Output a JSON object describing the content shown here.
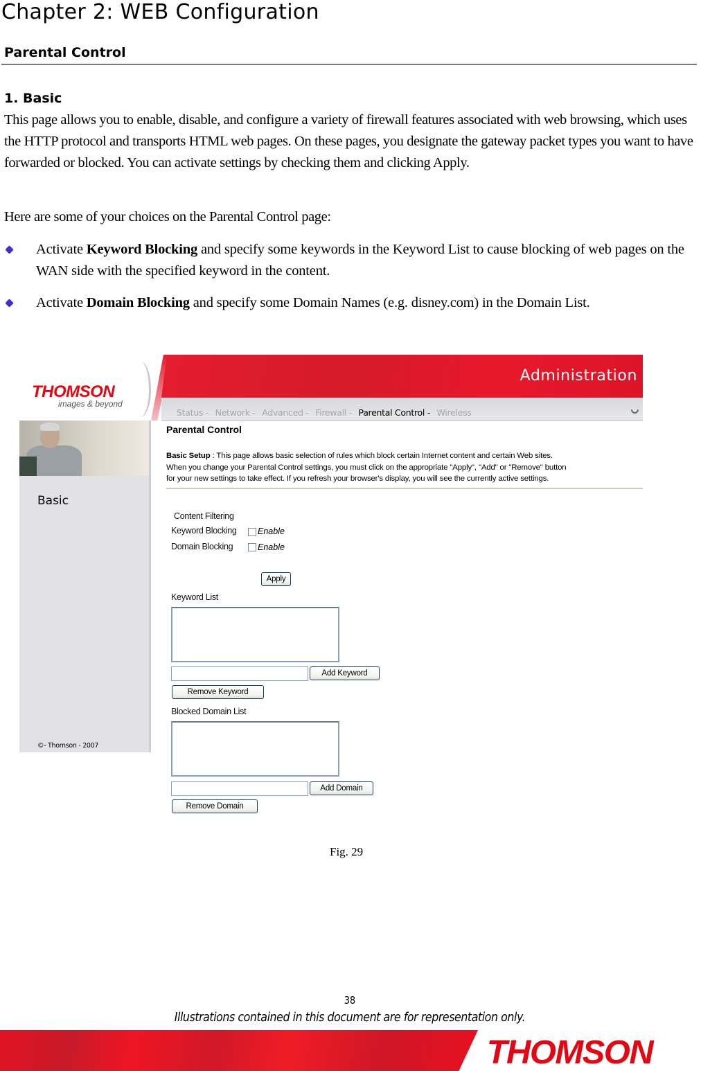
{
  "document": {
    "chapter_title": "Chapter 2: WEB Configuration",
    "section_title": "Parental Control",
    "subsection_title": "1. Basic",
    "paragraph_1": "This page allows you to enable, disable, and configure a variety of firewall features associated with web browsing, which uses the HTTP protocol and transports HTML web pages. On these pages, you designate the gateway packet types you want to have forwarded or blocked. You can activate settings by checking them and clicking Apply.",
    "paragraph_2": "Here are some of your choices on the Parental Control page:",
    "bullets": [
      {
        "prefix": "Activate ",
        "bold": "Keyword Blocking",
        "suffix": " and specify some keywords in the Keyword List to cause blocking of web pages on the WAN side with the specified keyword in the content."
      },
      {
        "prefix": "Activate ",
        "bold": "Domain Blocking",
        "suffix": " and specify some Domain Names (e.g. disney.com) in the Domain List."
      }
    ],
    "bullet_icon": "diamond-bullet-icon",
    "figure_caption": "Fig. 29",
    "page_number": "38",
    "disclaimer": "Illustrations contained in this document are for representation only.",
    "footer_logo": "THOMSON",
    "brand_color": "#e30613"
  },
  "screenshot": {
    "logo": "THOMSON",
    "tagline": "images & beyond",
    "header_title": "Administration",
    "nav": [
      {
        "label": "Status -",
        "active": false
      },
      {
        "label": "Network -",
        "active": false
      },
      {
        "label": "Advanced -",
        "active": false
      },
      {
        "label": "Firewall -",
        "active": false
      },
      {
        "label": "Parental Control -",
        "active": true
      },
      {
        "label": "Wireless",
        "active": false
      }
    ],
    "sidebar": {
      "item": "Basic",
      "copyright": "©- Thomson - 2007"
    },
    "page_title": "Parental Control",
    "setup_label": "Basic Setup",
    "setup_sep": " : ",
    "desc_line_1": "This page allows basic selection of rules which block certain Internet content and certain Web sites.",
    "desc_line_2": "When you change your Parental Control settings, you must click on the appropriate \"Apply\", \"Add\" or \"Remove\" button",
    "desc_line_3": "for your new settings to take effect. If you refresh your browser's display, you will see the currently active settings.",
    "content_filtering_label": "Content Filtering",
    "keyword_blocking_label": "Keyword Blocking",
    "keyword_blocking_enabled": false,
    "domain_blocking_label": "Domain Blocking",
    "domain_blocking_enabled": false,
    "enable_label": "Enable",
    "apply_button": "Apply",
    "keyword_list_label": "Keyword List",
    "keyword_list_items": [],
    "keyword_input_value": "",
    "add_keyword_button": "Add Keyword",
    "remove_keyword_button": "Remove Keyword",
    "domain_list_label": "Blocked Domain List",
    "domain_list_items": [],
    "domain_input_value": "",
    "add_domain_button": "Add Domain",
    "remove_domain_button": "Remove Domain"
  }
}
